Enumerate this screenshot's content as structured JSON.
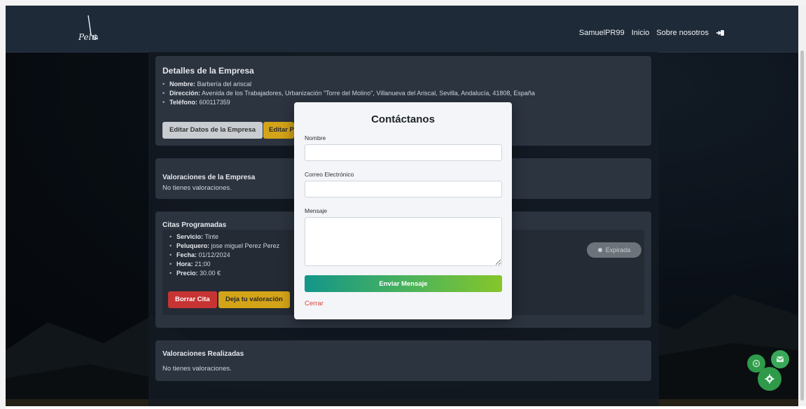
{
  "navbar": {
    "logo_text": "Pelu",
    "username": "SamuelPR99",
    "links": [
      "Inicio",
      "Sobre nosotros"
    ],
    "logout_icon": "logout-icon"
  },
  "company": {
    "title": "Detalles de la Empresa",
    "fields": [
      {
        "label": "Nombre:",
        "value": "Barbería del ariscal"
      },
      {
        "label": "Dirección:",
        "value": "Avenida de los Trabajadores, Urbanización \"Torre del Molino\", Villanueva del Ariscal, Sevilla, Andalucía, 41808, España"
      },
      {
        "label": "Teléfono:",
        "value": "600117359"
      }
    ],
    "edit_button": "Editar Datos de la Empresa",
    "edit_button2": "Editar P"
  },
  "company_ratings": {
    "title": "Valoraciones de la Empresa",
    "empty": "No tienes valoraciones."
  },
  "appointments": {
    "title": "Citas Programadas",
    "items": [
      {
        "fields": [
          {
            "label": "Servicio:",
            "value": "Tinte"
          },
          {
            "label": "Peluquero:",
            "value": "jose miguel Perez Perez"
          },
          {
            "label": "Fecha:",
            "value": "01/12/2024"
          },
          {
            "label": "Hora:",
            "value": "21:00"
          },
          {
            "label": "Precio:",
            "value": "30.00 €"
          }
        ],
        "status": "Expirada",
        "delete_button": "Borrar Cita",
        "rate_button": "Deja tu valoración"
      }
    ]
  },
  "ratings_done": {
    "title": "Valoraciones Realizadas",
    "empty": "No tienes valoraciones."
  },
  "modal": {
    "title": "Contáctanos",
    "name_label": "Nombre",
    "email_label": "Correo Electrónico",
    "message_label": "Mensaje",
    "submit": "Enviar Mensaje",
    "close": "Cerrar"
  },
  "floating": {
    "colors": {
      "green_dark": "#2e9a4a",
      "green_light": "#3aa85a"
    },
    "icons": [
      "chat-icon",
      "mail-icon",
      "gear-icon"
    ]
  }
}
